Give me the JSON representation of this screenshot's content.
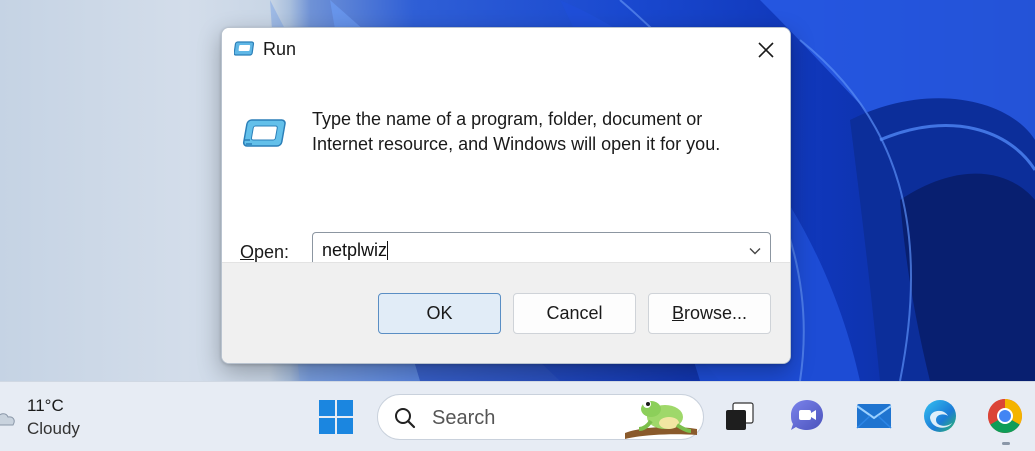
{
  "dialog": {
    "title": "Run",
    "description_line1": "Type the name of a program, folder, document or",
    "description_line2": "Internet resource, and Windows will open it for you.",
    "open_label_hotkey": "O",
    "open_label_rest": "pen:",
    "open_value": "netplwiz",
    "buttons": {
      "ok": "OK",
      "cancel": "Cancel",
      "browse_hotkey": "B",
      "browse_rest": "rowse..."
    }
  },
  "taskbar": {
    "weather": {
      "temperature": "11°C",
      "condition": "Cloudy",
      "icon": "cloud-icon"
    },
    "search": {
      "placeholder": "Search"
    },
    "apps": [
      {
        "name": "Start",
        "icon": "windows-logo-icon"
      },
      {
        "name": "Task View",
        "icon": "task-view-icon"
      },
      {
        "name": "Teams Chat",
        "icon": "chat-icon"
      },
      {
        "name": "Mail",
        "icon": "mail-icon"
      },
      {
        "name": "Edge",
        "icon": "edge-icon"
      },
      {
        "name": "Chrome",
        "icon": "chrome-icon"
      }
    ]
  },
  "colors": {
    "accent": "#1a5fb4",
    "ok_button_bg": "#e1ecf7",
    "dialog_footer": "#f0f0f0",
    "wallpaper_blue": "#1a49d0"
  }
}
